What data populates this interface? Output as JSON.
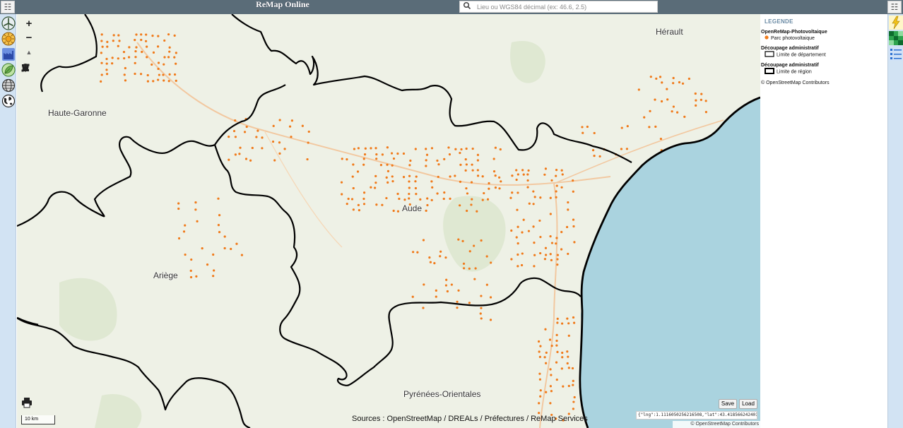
{
  "header": {
    "title": "ReMap Online",
    "search_placeholder": "Lieu ou WGS84 décimal (ex: 46.6, 2.5)",
    "menu_glyph": "☷"
  },
  "left_toolbar": {
    "buttons": [
      {
        "icon": "wind-turbine-icon",
        "color": "#2f4f2f"
      },
      {
        "icon": "sun-icon",
        "color": "#f1a21a"
      },
      {
        "icon": "factory-icon",
        "color": "#4a6fd0"
      },
      {
        "icon": "leaf-icon",
        "color": "#6ab04c"
      },
      {
        "icon": "globe-grid-icon",
        "color": "#555555"
      },
      {
        "icon": "earth-icon",
        "color": "#333333"
      }
    ]
  },
  "right_toolbar": {
    "buttons": [
      {
        "icon": "lightning-icon",
        "color": "#f2c21a"
      },
      {
        "icon": "grid-layers-icon",
        "color": "#2ea44f"
      },
      {
        "icon": "list-legend-icon",
        "color": "#2a6fd0"
      }
    ]
  },
  "map_controls": {
    "zoom_in": "+",
    "zoom_out": "−",
    "north": "▲",
    "draw_tools": [
      "line-tool-icon",
      "polygon-tool-icon",
      "marker-tool-icon",
      "delete-tool-icon"
    ]
  },
  "places": [
    {
      "name": "Haute-Garonne"
    },
    {
      "name": "Hérault"
    },
    {
      "name": "Aude"
    },
    {
      "name": "Ariège"
    },
    {
      "name": "Pyrénées-Orientales"
    }
  ],
  "colors": {
    "sea": "#aad3df",
    "land": "#eef1e6",
    "pv_dot": "#f07a1a",
    "boundary": "#000000",
    "legend_title": "#6a8aa4"
  },
  "legend": {
    "title": "LEGENDE",
    "groups": [
      {
        "name": "OpenReMap-Photovoltaique",
        "items": [
          {
            "label": "Parc photovoltaique",
            "symbol": "dot",
            "color": "#f07a1a"
          }
        ]
      },
      {
        "name": "Découpage administratif",
        "items": [
          {
            "label": "Limite de département",
            "symbol": "box"
          }
        ]
      },
      {
        "name": "Découpage administratif",
        "items": [
          {
            "label": "Limite de région",
            "symbol": "box-thick"
          }
        ]
      }
    ],
    "attribution": "© OpenStreetMap Contributors"
  },
  "footer": {
    "sources": "Sources : OpenStreetMap / DREALs / Préfectures / ReMap Services",
    "scale": "10 km",
    "save": "Save",
    "load": "Load",
    "coords": "{\"lng\":1.1116050256216508,\"lat\":43.41856624240179}",
    "osm_attribution": "© OpenStreetMap Contributors"
  }
}
